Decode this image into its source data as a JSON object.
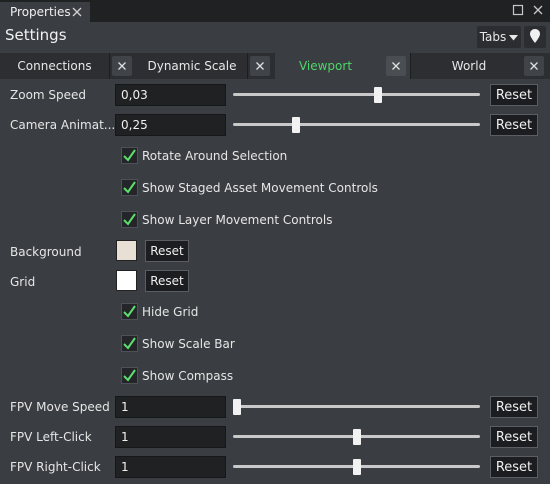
{
  "panel": {
    "tab_label": "Properties",
    "title": "Settings"
  },
  "toolbar": {
    "tabs_label": "Tabs"
  },
  "tabs": [
    {
      "label": "Connections",
      "active": false
    },
    {
      "label": "Dynamic Scale",
      "active": false
    },
    {
      "label": "Viewport",
      "active": true
    },
    {
      "label": "World",
      "active": false
    }
  ],
  "settings": {
    "zoom_speed": {
      "label": "Zoom Speed",
      "value": "0,03",
      "slider": 0.59,
      "reset": "Reset"
    },
    "camera_animation": {
      "label": "Camera Animat...",
      "value": "0,25",
      "slider": 0.245,
      "reset": "Reset"
    },
    "rotate_around_selection": {
      "label": "Rotate Around Selection",
      "checked": true
    },
    "staged_asset_controls": {
      "label": "Show Staged Asset Movement Controls",
      "checked": true
    },
    "layer_controls": {
      "label": "Show Layer Movement Controls",
      "checked": true
    },
    "background": {
      "label": "Background",
      "color": "#e8e0d4",
      "reset": "Reset"
    },
    "grid": {
      "label": "Grid",
      "color": "#ffffff",
      "reset": "Reset"
    },
    "hide_grid": {
      "label": "Hide Grid",
      "checked": true
    },
    "show_scale_bar": {
      "label": "Show Scale Bar",
      "checked": true
    },
    "show_compass": {
      "label": "Show Compass",
      "checked": true
    },
    "fpv_move_speed": {
      "label": "FPV Move Speed",
      "value": "1",
      "slider": 0.0,
      "reset": "Reset"
    },
    "fpv_left_click": {
      "label": "FPV Left-Click",
      "value": "1",
      "slider": 0.5,
      "reset": "Reset"
    },
    "fpv_right_click": {
      "label": "FPV Right-Click",
      "value": "1",
      "slider": 0.5,
      "reset": "Reset"
    }
  },
  "colors": {
    "accent": "#4ed66a",
    "check": "#5ee06e"
  }
}
